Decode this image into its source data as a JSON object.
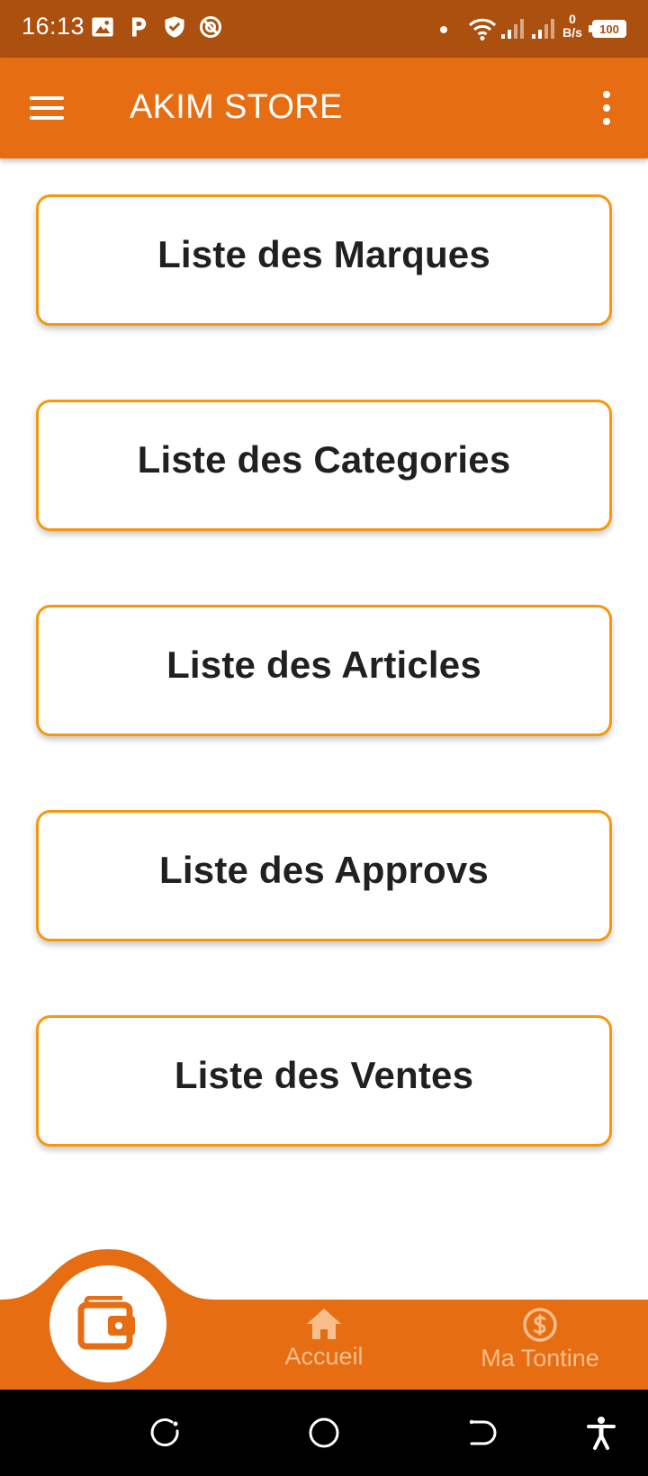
{
  "status_bar": {
    "time": "16:13",
    "net_speed_value": "0",
    "net_speed_unit": "B/s",
    "battery": "100",
    "icons": [
      "image-icon",
      "parking-p-icon",
      "shield-check-icon",
      "no-sync-icon",
      "dot-icon",
      "wifi-icon",
      "signal-icon",
      "signal-icon",
      "battery-icon"
    ]
  },
  "app_bar": {
    "title": "AKIM STORE",
    "menu_icon": "hamburger-menu-icon",
    "more_icon": "more-vert-icon"
  },
  "menu": {
    "items": [
      {
        "label": "Liste des Marques"
      },
      {
        "label": "Liste des Categories"
      },
      {
        "label": "Liste des Articles"
      },
      {
        "label": "Liste des Approvs"
      },
      {
        "label": "Liste des Ventes"
      }
    ]
  },
  "bottom_nav": {
    "fab_icon": "wallet-icon",
    "items": [
      {
        "label": "Accueil",
        "icon": "home-icon"
      },
      {
        "label": "Ma Tontine",
        "icon": "dollar-circle-icon"
      }
    ]
  },
  "system_nav": {
    "icons": [
      "rotate-icon",
      "home-circle-icon",
      "back-icon",
      "accessibility-icon"
    ]
  },
  "colors": {
    "status_bar": "#AB500E",
    "primary": "#E66D12",
    "button_border": "#F5980E",
    "nav_inactive": "#F8BE8C",
    "text_dark": "#202020"
  }
}
